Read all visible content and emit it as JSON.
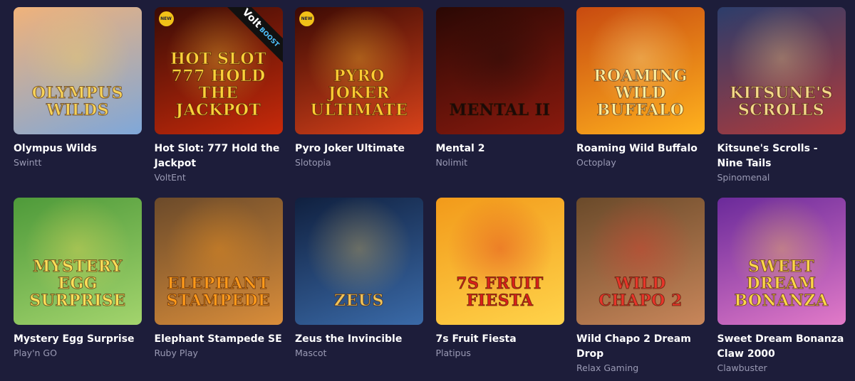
{
  "badges": {
    "new": "NEW",
    "volt": "Volt",
    "boost": "BOOST"
  },
  "games": [
    {
      "title": "Olympus Wilds",
      "provider": "Swintt",
      "logo": "Olympus Wilds",
      "new": false,
      "volt": false,
      "colors": {
        "bg1": "#f0b27a",
        "bg2": "#7fa7d9",
        "text": "#f7d35a"
      }
    },
    {
      "title": "Hot Slot: 777 Hold the Jackpot",
      "provider": "VoltEnt",
      "logo": "Hot Slot 777 Hold the Jackpot",
      "new": true,
      "volt": true,
      "colors": {
        "bg1": "#3a0c06",
        "bg2": "#c92a0a",
        "text": "#ffd23a"
      }
    },
    {
      "title": "Pyro Joker Ultimate",
      "provider": "Slotopia",
      "logo": "Pyro Joker Ultimate",
      "new": true,
      "volt": false,
      "colors": {
        "bg1": "#3b0a04",
        "bg2": "#d8421a",
        "text": "#ffcc33"
      }
    },
    {
      "title": "Mental 2",
      "provider": "Nolimit",
      "logo": "Mental II",
      "new": false,
      "volt": false,
      "colors": {
        "bg1": "#2a0804",
        "bg2": "#8a1a0e",
        "text": "#1a0a08"
      }
    },
    {
      "title": "Roaming Wild Buffalo",
      "provider": "Octoplay",
      "logo": "Roaming Wild Buffalo",
      "new": false,
      "volt": false,
      "colors": {
        "bg1": "#c84a10",
        "bg2": "#ffb21e",
        "text": "#fff0a0"
      }
    },
    {
      "title": "Kitsune's Scrolls - Nine Tails",
      "provider": "Spinomenal",
      "logo": "Kitsune's Scrolls",
      "new": false,
      "volt": false,
      "colors": {
        "bg1": "#2c3d6b",
        "bg2": "#b23a3a",
        "text": "#f4d98a"
      }
    },
    {
      "title": "Mystery Egg Surprise",
      "provider": "Play'n GO",
      "logo": "Mystery Egg Surprise",
      "new": false,
      "volt": false,
      "colors": {
        "bg1": "#4e9a3a",
        "bg2": "#a3d46d",
        "text": "#ffe05a"
      }
    },
    {
      "title": "Elephant Stampede SE",
      "provider": "Ruby Play",
      "logo": "Elephant Stampede",
      "new": false,
      "volt": false,
      "colors": {
        "bg1": "#6b4a2a",
        "bg2": "#d98d3a",
        "text": "#ff9a1a"
      }
    },
    {
      "title": "Zeus the Invincible",
      "provider": "Mascot",
      "logo": "Zeus",
      "new": false,
      "volt": false,
      "colors": {
        "bg1": "#10203f",
        "bg2": "#3a6aa8",
        "text": "#f0c45a"
      }
    },
    {
      "title": "7s Fruit Fiesta",
      "provider": "Platipus",
      "logo": "7s Fruit Fiesta",
      "new": false,
      "volt": false,
      "colors": {
        "bg1": "#f29a1a",
        "bg2": "#ffd34a",
        "text": "#d8201a"
      }
    },
    {
      "title": "Wild Chapo 2 Dream Drop",
      "provider": "Relax Gaming",
      "logo": "Wild Chapo 2",
      "new": false,
      "volt": false,
      "colors": {
        "bg1": "#6a4a2a",
        "bg2": "#c8865a",
        "text": "#e8352a"
      }
    },
    {
      "title": "Sweet Dream Bonanza Claw 2000",
      "provider": "Clawbuster",
      "logo": "Sweet Dream Bonanza",
      "new": false,
      "volt": false,
      "colors": {
        "bg1": "#6a2a9a",
        "bg2": "#e27ac8",
        "text": "#ffd84a"
      }
    }
  ]
}
